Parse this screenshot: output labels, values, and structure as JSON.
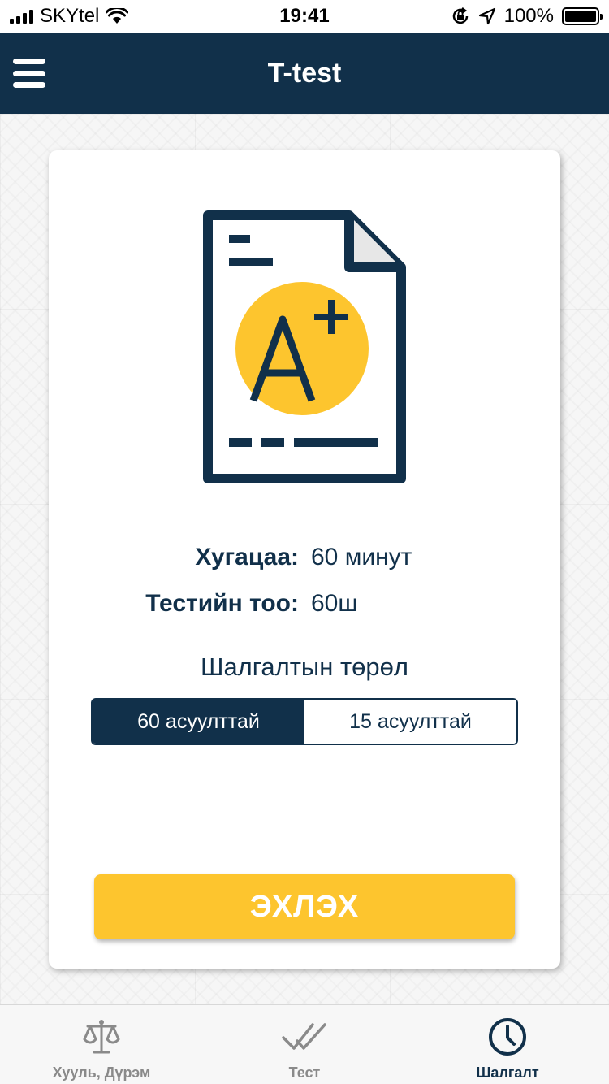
{
  "status_bar": {
    "carrier": "SKYtel",
    "time": "19:41",
    "battery": "100%"
  },
  "nav": {
    "title": "T-test",
    "menu_icon": "hamburger-menu-icon"
  },
  "card": {
    "illustration_icon": "document-grade-a-plus-icon",
    "illustration_grade": "A+",
    "duration_label": "Хугацаа:",
    "duration_value": "60 минут",
    "count_label": "Тестийн тоо:",
    "count_value": "60ш",
    "type_label": "Шалгалтын төрөл",
    "type_options": [
      {
        "label": "60 асуулттай",
        "selected": true
      },
      {
        "label": "15 асуулттай",
        "selected": false
      }
    ],
    "start_label": "ЭХЛЭХ"
  },
  "tab_bar": {
    "items": [
      {
        "label": "Хууль, Дүрэм",
        "icon": "scales-icon",
        "active": false
      },
      {
        "label": "Тест",
        "icon": "double-check-icon",
        "active": false
      },
      {
        "label": "Шалгалт",
        "icon": "clock-icon",
        "active": true
      }
    ]
  },
  "colors": {
    "primary": "#11304a",
    "accent": "#fdc52e",
    "inactive": "#8a8a8a"
  }
}
